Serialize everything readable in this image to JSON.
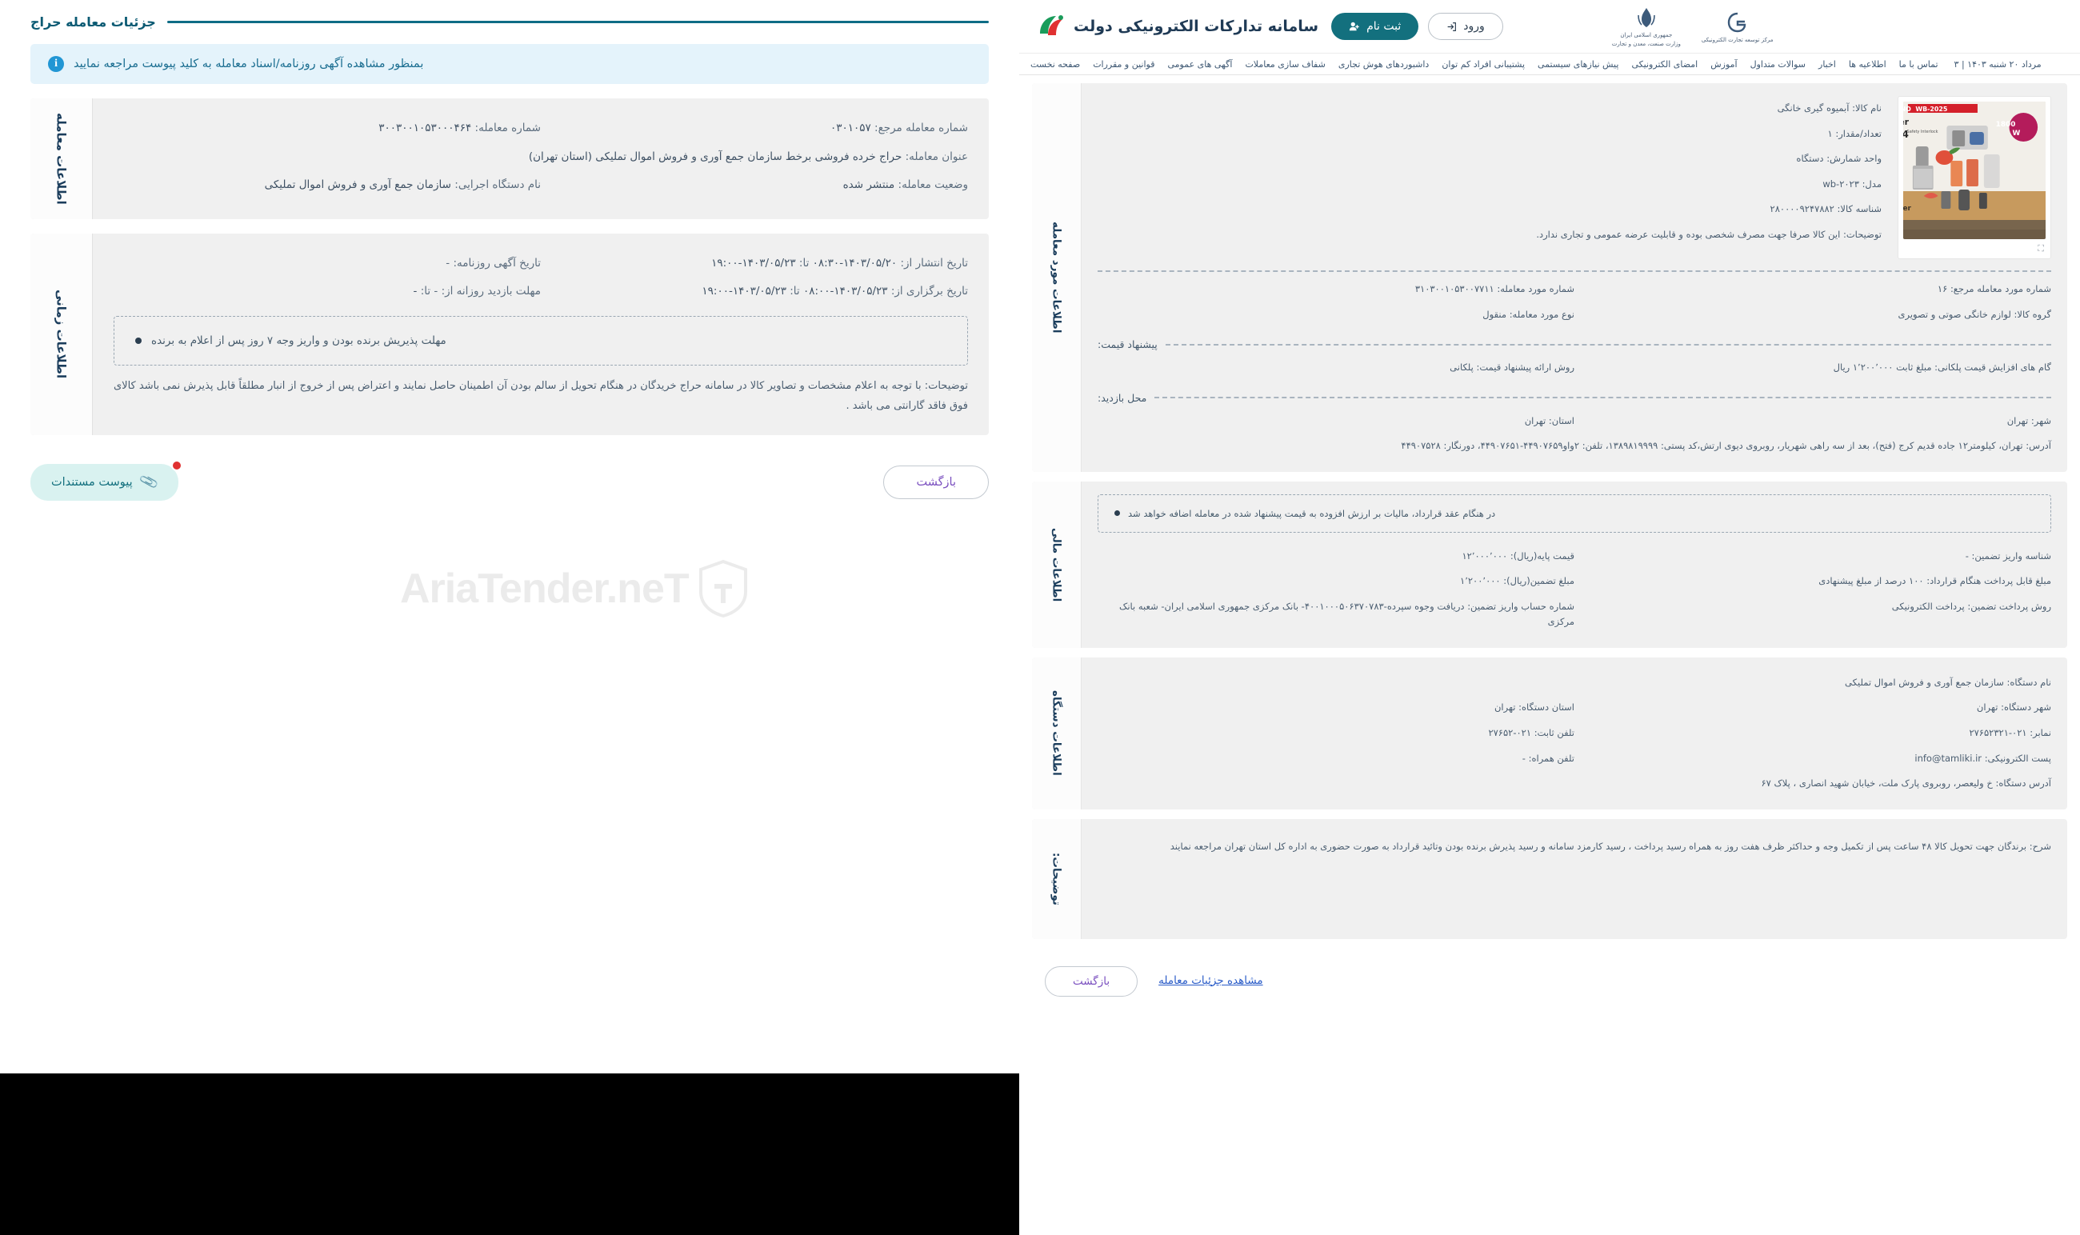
{
  "left_window": {
    "page_title": "جزئیات معامله حراج",
    "info_banner": {
      "icon": "info-icon",
      "text": "بمنظور مشاهده آگهی روزنامه/اسناد معامله به کلید پیوست مراجعه نمایید"
    },
    "transaction_info": {
      "tab_label": "اطلاعات معامله",
      "fields": [
        {
          "label": "شماره معامله:",
          "value": "۳۰۰۳۰۰۱۰۵۳۰۰۰۴۶۴"
        },
        {
          "label": "شماره معامله مرجع:",
          "value": "۰۳۰۱۰۵۷"
        },
        {
          "label": "عنوان معامله:",
          "value": "حراج خرده فروشی برخط سازمان جمع آوری و فروش اموال تملیکی (استان تهران)"
        },
        {
          "label": "نام دستگاه اجرایی:",
          "value": "سازمان جمع آوری و فروش اموال تملیکی"
        },
        {
          "label": "وضعیت معامله:",
          "value": "منتشر شده"
        }
      ]
    },
    "time_info": {
      "tab_label": "اطلاعات زمانی",
      "fields": [
        {
          "label": "تاریخ آگهی روزنامه: -",
          "value": ""
        },
        {
          "label": "تاریخ انتشار از:",
          "value": "۱۴۰۳/۰۵/۲۰-۰۸:۳۰",
          "to_label": "تا:",
          "to_value": "۱۴۰۳/۰۵/۲۳-۱۹:۰۰"
        },
        {
          "label": "مهلت بازدید روزانه از:  -",
          "value": "",
          "to_label": "تا:",
          "to_value": "-"
        },
        {
          "label": "تاریخ برگزاری از:",
          "value": "۱۴۰۳/۰۵/۲۳-۰۸:۰۰",
          "to_label": "تا:",
          "to_value": "۱۴۰۳/۰۵/۲۳-۱۹:۰۰"
        }
      ],
      "dashed_note": "مهلت پذیریش برنده بودن و واریز وجه ۷ روز پس از اعلام به برنده",
      "note": "توضیحات: با توجه به اعلام مشخصات و تصاویر کالا در سامانه حراج خریدگان در هنگام تحویل از سالم بودن آن اطمینان حاصل نمایند و اعتراض پس از خروج از انبار مطلقاً قابل پذیرش نمی باشد کالای فوق فاقد گارانتی می باشد ."
    },
    "actions": {
      "attach_label": "پیوست مستندات",
      "attach_icon": "paperclip-icon",
      "back_label": "بازگشت"
    },
    "watermark": "AriaTender.neT"
  },
  "right_window": {
    "header": {
      "brand_title": "سامانه تدارکات الکترونیکی دولت",
      "logo_icon": "setad-logo-icon",
      "register_label": "ثبت نام",
      "register_icon": "user-plus-icon",
      "register_color": "#13707e",
      "login_label": "ورود",
      "login_icon": "login-arrow-icon",
      "gov_emblem_1": "جمهوری اسلامی ایران",
      "gov_emblem_1_sub": "وزارت صنعت، معدن و تجارت",
      "gov_emblem_2": "مرکز توسعه تجارت الکترونیکی"
    },
    "nav": {
      "items": [
        "صفحه نخست",
        "قوانین و مقررات",
        "آگهی های عمومی",
        "شفاف سازی معاملات",
        "داشبوردهای هوش تجاری",
        "پشتیبانی افراد کم توان",
        "پیش نیازهای سیستمی",
        "امضای الکترونیکی",
        "آموزش",
        "سوالات متداول",
        "اخبار",
        "اطلاعیه ها",
        "تماس با ما"
      ],
      "date": "مرداد ۲۰ شنبه ۱۴۰۳  |  ۳"
    },
    "item_info": {
      "tab_label": "اطلاعات مورد معامله",
      "product": {
        "name_label": "نام کالا:",
        "name_value": "آبمیوه گیری خانگی",
        "qty_label": "تعداد/مقدار:",
        "qty_value": "۱",
        "unit_label": "واحد شمارش:",
        "unit_value": "دستگاه",
        "model_label": "مدل:",
        "model_value": "wb-۲۰۲۳",
        "code_label": "شناسه کالا:",
        "code_value": "۲۸۰۰۰۰۹۲۴۷۸۸۲",
        "desc_label": "توضیحات:",
        "desc_value": "این کالا صرفا جهت مصرف شخصی بوده و قابلیت عرضه عمومی و تجاری ندارد.",
        "image_alt": "Stainless Steel Juicer 4 In 1 — Model NO: WB-2025 — 1800W — Juicer & Blender",
        "expand_icon": "expand-icon"
      },
      "fields": [
        {
          "label": "شماره مورد معامله:",
          "value": "۳۱۰۳۰۰۱۰۵۳۰۰۷۷۱۱"
        },
        {
          "label": "شماره مورد معامله مرجع:",
          "value": "۱۶"
        },
        {
          "label": "نوع مورد معامله:",
          "value": "منقول"
        },
        {
          "label": "گروه کالا:",
          "value": "لوازم خانگی صوتی و تصویری"
        }
      ],
      "price_offer_heading": "پیشنهاد قیمت:",
      "price_fields": [
        {
          "label": "روش ارائه پیشنهاد قیمت:",
          "value": "پلکانی"
        },
        {
          "label": "گام های افزایش قیمت پلکانی:",
          "value": "مبلغ ثابت ۱٬۲۰۰٬۰۰۰ ریال"
        }
      ],
      "visit_heading": "محل بازدید:",
      "visit_fields": [
        {
          "label": "استان:",
          "value": "تهران"
        },
        {
          "label": "شهر:",
          "value": "تهران"
        }
      ],
      "address_label": "آدرس:",
      "address_value": "تهران، کیلومتر۱۲ جاده قدیم کرج (فتح)، بعد از سه راهی شهریار، روبروی دیوی ارتش،کد پستی: ۱۳۸۹۸۱۹۹۹۹، تلفن: ۲واو۴۴۹۰۷۶۵۹-۴۴۹۰۷۶۵۱، دورنگار: ۴۴۹۰۷۵۲۸"
    },
    "financial_info": {
      "tab_label": "اطلاعات مالی",
      "dashed_note": "در هنگام عقد قرارداد، مالیات بر ارزش افزوده به قیمت پیشنهاد شده در معامله اضافه خواهد شد",
      "fields": [
        {
          "label": "قیمت پایه(ریال):",
          "value": "۱۲٬۰۰۰٬۰۰۰"
        },
        {
          "label": "شناسه واریز تضمین:",
          "value": "-"
        },
        {
          "label": "مبلغ تضمین(ریال):",
          "value": "۱٬۲۰۰٬۰۰۰"
        },
        {
          "label": "مبلغ قابل پرداخت هنگام قرارداد:",
          "value": "۱۰۰ درصد از مبلغ پیشنهادی"
        },
        {
          "label": "شماره حساب واریز تضمین:",
          "value": "دریافت وجوه سپرده-۴۰۰۱۰۰۰۵۰۶۳۷۰۷۸۳- بانک مرکزی جمهوری اسلامی ایران- شعبه بانک مرکزی"
        },
        {
          "label": "روش پرداخت تضمین:",
          "value": "پرداخت الکترونیکی"
        }
      ]
    },
    "agency_info": {
      "tab_label": "اطلاعات دستگاه",
      "fields": [
        {
          "label": "نام دستگاه:",
          "value": "سازمان جمع آوری و فروش اموال تملیکی"
        },
        {
          "label": "استان دستگاه:",
          "value": "تهران"
        },
        {
          "label": "شهر دستگاه:",
          "value": "تهران"
        },
        {
          "label": "تلفن ثابت:",
          "value": "۰۲۱-۲۷۶۵۲"
        },
        {
          "label": "نمابر:",
          "value": "۰۲۱-۲۷۶۵۲۳۲۱"
        },
        {
          "label": "تلفن همراه:",
          "value": "-"
        },
        {
          "label": "پست الکترونیکی:",
          "value": "info@tamliki.ir"
        },
        {
          "label": "آدرس دستگاه:",
          "value": "خ ولیعصر، روبروی پارک ملت، خیابان شهید انصاری ، پلاک ۶۷"
        }
      ]
    },
    "notes": {
      "tab_label": "توضیحات:",
      "label": "شرح:",
      "value": "برندگان جهت تحویل کالا ۴۸ ساعت پس از تکمیل وجه و حداکثر ظرف هفت روز به همراه رسید پرداخت ، رسید کارمزد سامانه و رسید پذیرش برنده بودن وتائید قرارداد به صورت حضوری به اداره کل استان تهران مراجعه نمایند"
    },
    "footer": {
      "back_label": "بازگشت",
      "details_link_label": "مشاهده جزئیات معامله"
    }
  }
}
